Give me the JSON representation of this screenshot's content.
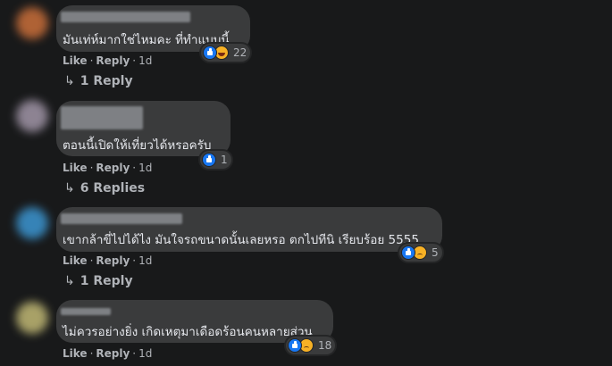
{
  "comments": [
    {
      "text": "มันเท่ห์มากใช่ไหมคะ ที่ทำแบบนี้",
      "reactions": [
        "like-icon",
        "haha-icon"
      ],
      "reaction_count": "22",
      "like_label": "Like",
      "reply_label": "Reply",
      "time": "1d",
      "replies_label": "1 Reply",
      "avatar_color": "#c06a38"
    },
    {
      "text": "ตอนนี้เปิดให้เที่ยวได้หรอครับ",
      "reactions": [
        "like-icon"
      ],
      "reaction_count": "1",
      "like_label": "Like",
      "reply_label": "Reply",
      "time": "1d",
      "replies_label": "6 Replies",
      "avatar_color": "#9a8fa0"
    },
    {
      "text": "เขากล้าขี่ไปได้ไง มันใจรถขนาดนั้นเลยหรอ ตกไปทีนิ เรียบร้อย 5555",
      "reactions": [
        "like-icon",
        "sad-icon"
      ],
      "reaction_count": "5",
      "like_label": "Like",
      "reply_label": "Reply",
      "time": "1d",
      "replies_label": "1 Reply",
      "avatar_color": "#3a8fc8"
    },
    {
      "text": "ไม่ควรอย่างยิ่ง เกิดเหตุมาเดือดร้อนคนหลายส่วน",
      "reactions": [
        "like-icon",
        "sad-icon"
      ],
      "reaction_count": "18",
      "like_label": "Like",
      "reply_label": "Reply",
      "time": "1d",
      "avatar_color": "#b8b070"
    }
  ]
}
